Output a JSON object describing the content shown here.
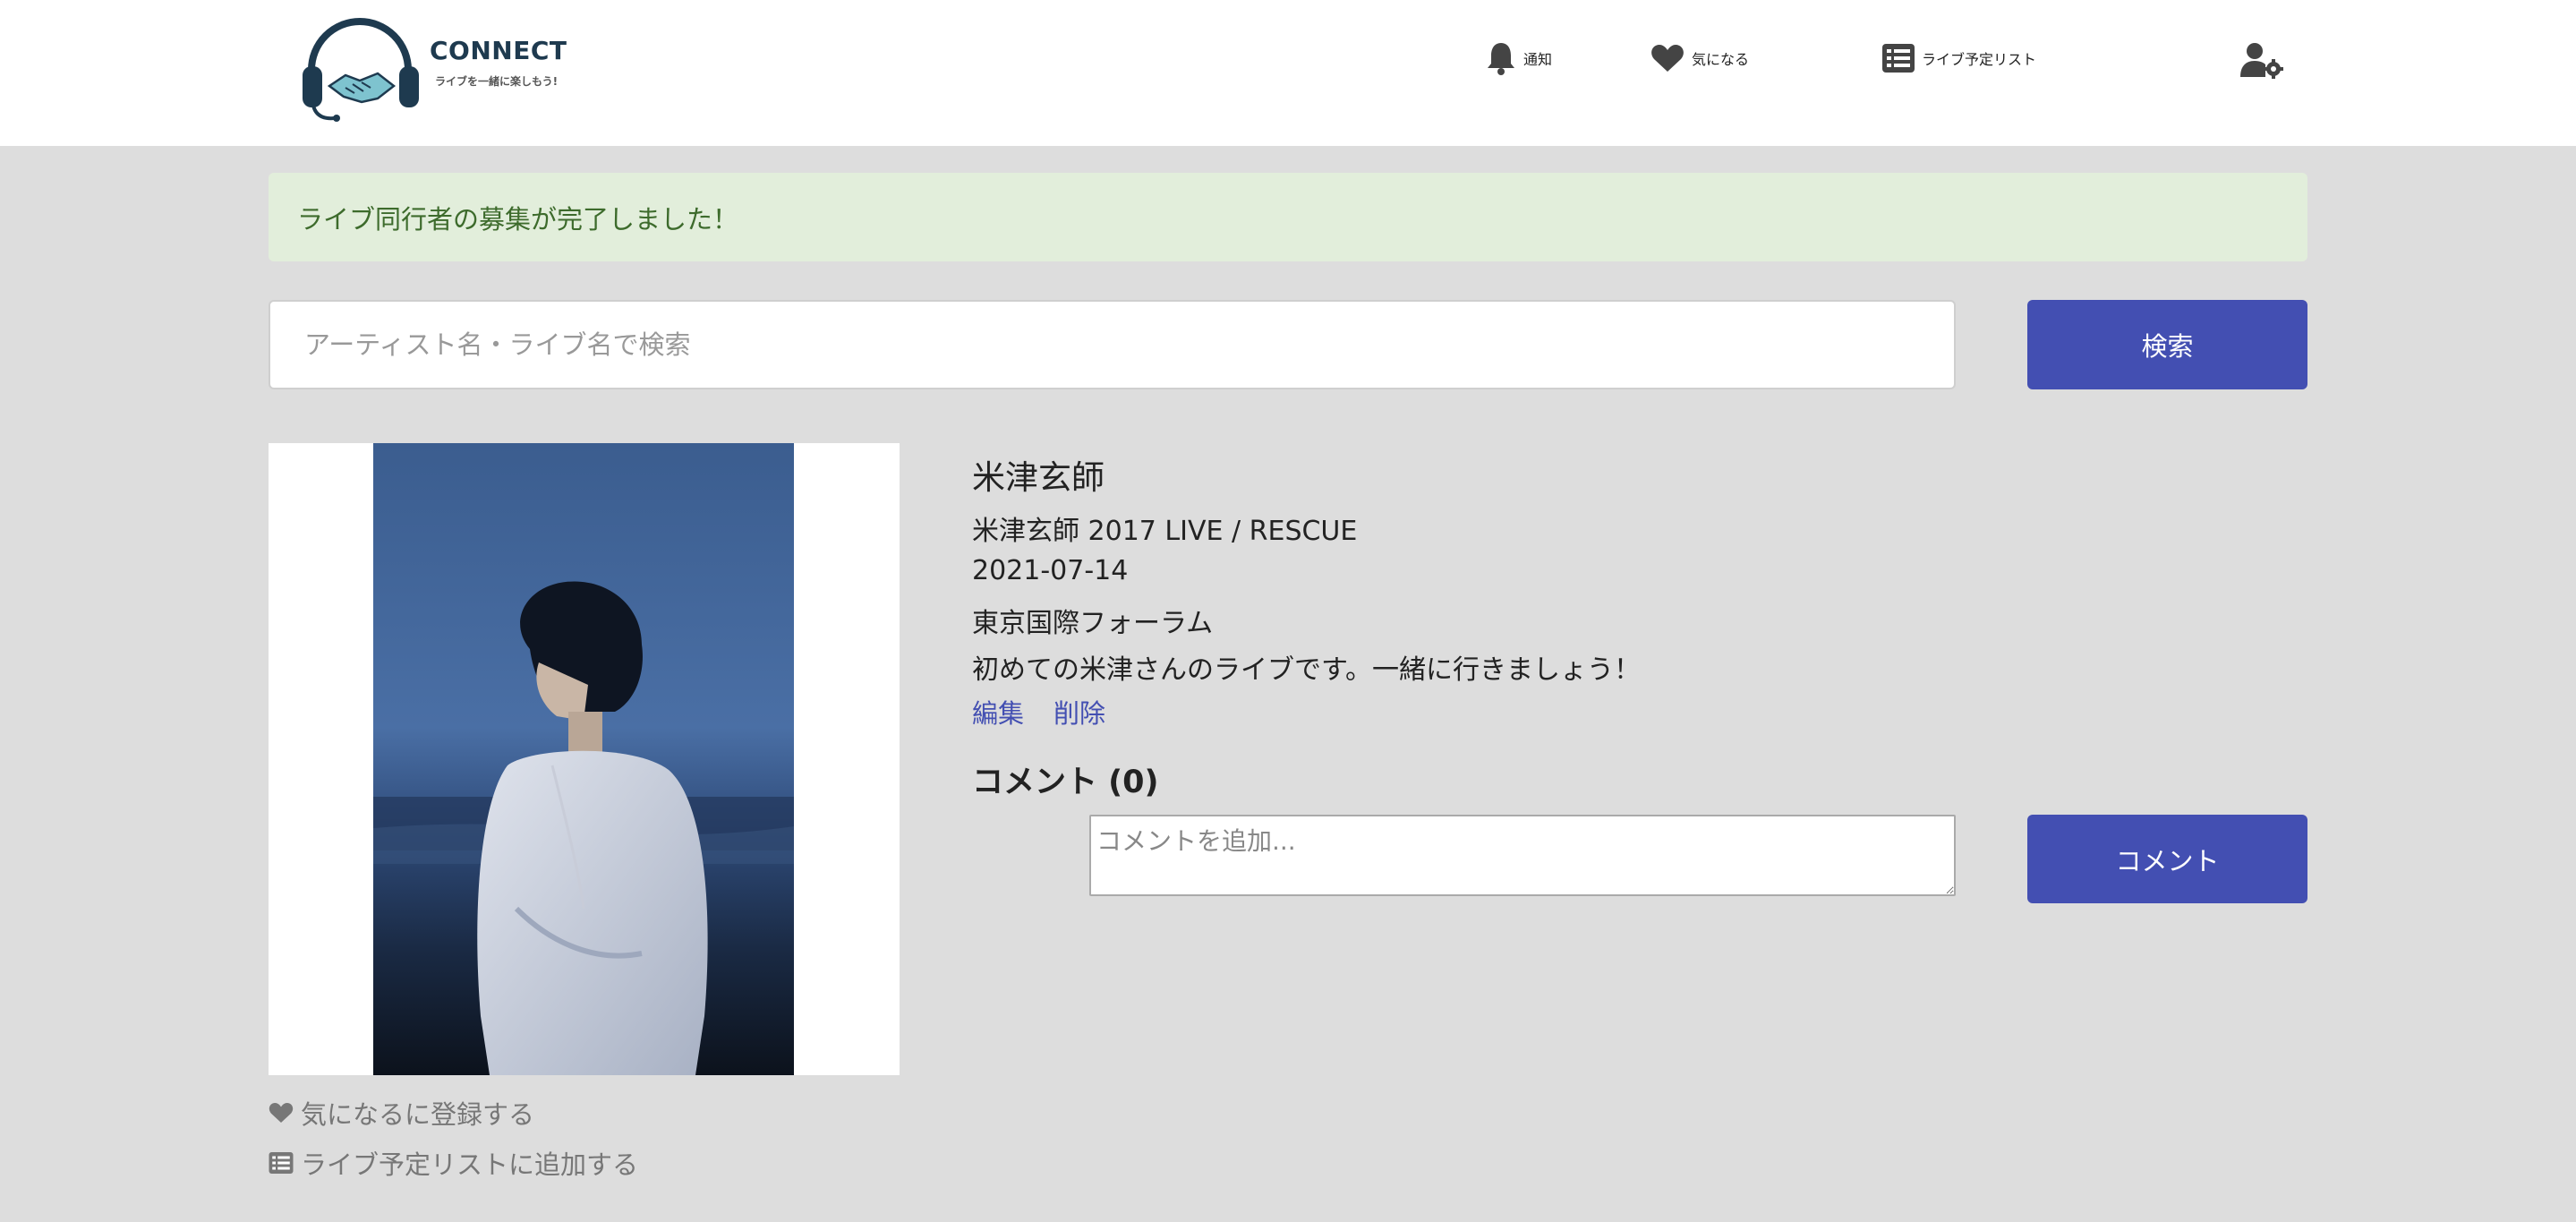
{
  "header": {
    "logo": {
      "title": "CONNECT",
      "subtitle": "ライブを一緒に楽しもう!"
    },
    "nav": [
      {
        "label": "通知",
        "icon": "bell-icon"
      },
      {
        "label": "気になる",
        "icon": "heart-icon"
      },
      {
        "label": "ライブ予定リスト",
        "icon": "list-icon"
      },
      {
        "label": "",
        "icon": "user-settings-icon"
      }
    ]
  },
  "alert": {
    "message": "ライブ同行者の募集が完了しました！"
  },
  "search": {
    "placeholder": "アーティスト名・ライブ名で検索",
    "button_label": "検索"
  },
  "live": {
    "artist": "米津玄師",
    "title": "米津玄師 2017 LIVE / RESCUE",
    "date": "2021-07-14",
    "venue": "東京国際フォーラム",
    "message": "初めての米津さんのライブです。一緒に行きましょう！",
    "edit_label": "編集",
    "delete_label": "削除"
  },
  "actions": {
    "favorite_label": "気になるに登録する",
    "schedule_label": "ライブ予定リストに追加する"
  },
  "comments": {
    "heading": "コメント (0)",
    "placeholder": "コメントを追加...",
    "button_label": "コメント"
  },
  "colors": {
    "accent": "#434fb2",
    "alert_bg": "#e2eedb",
    "alert_text": "#3d6b2c",
    "page_bg": "#dddddd"
  }
}
